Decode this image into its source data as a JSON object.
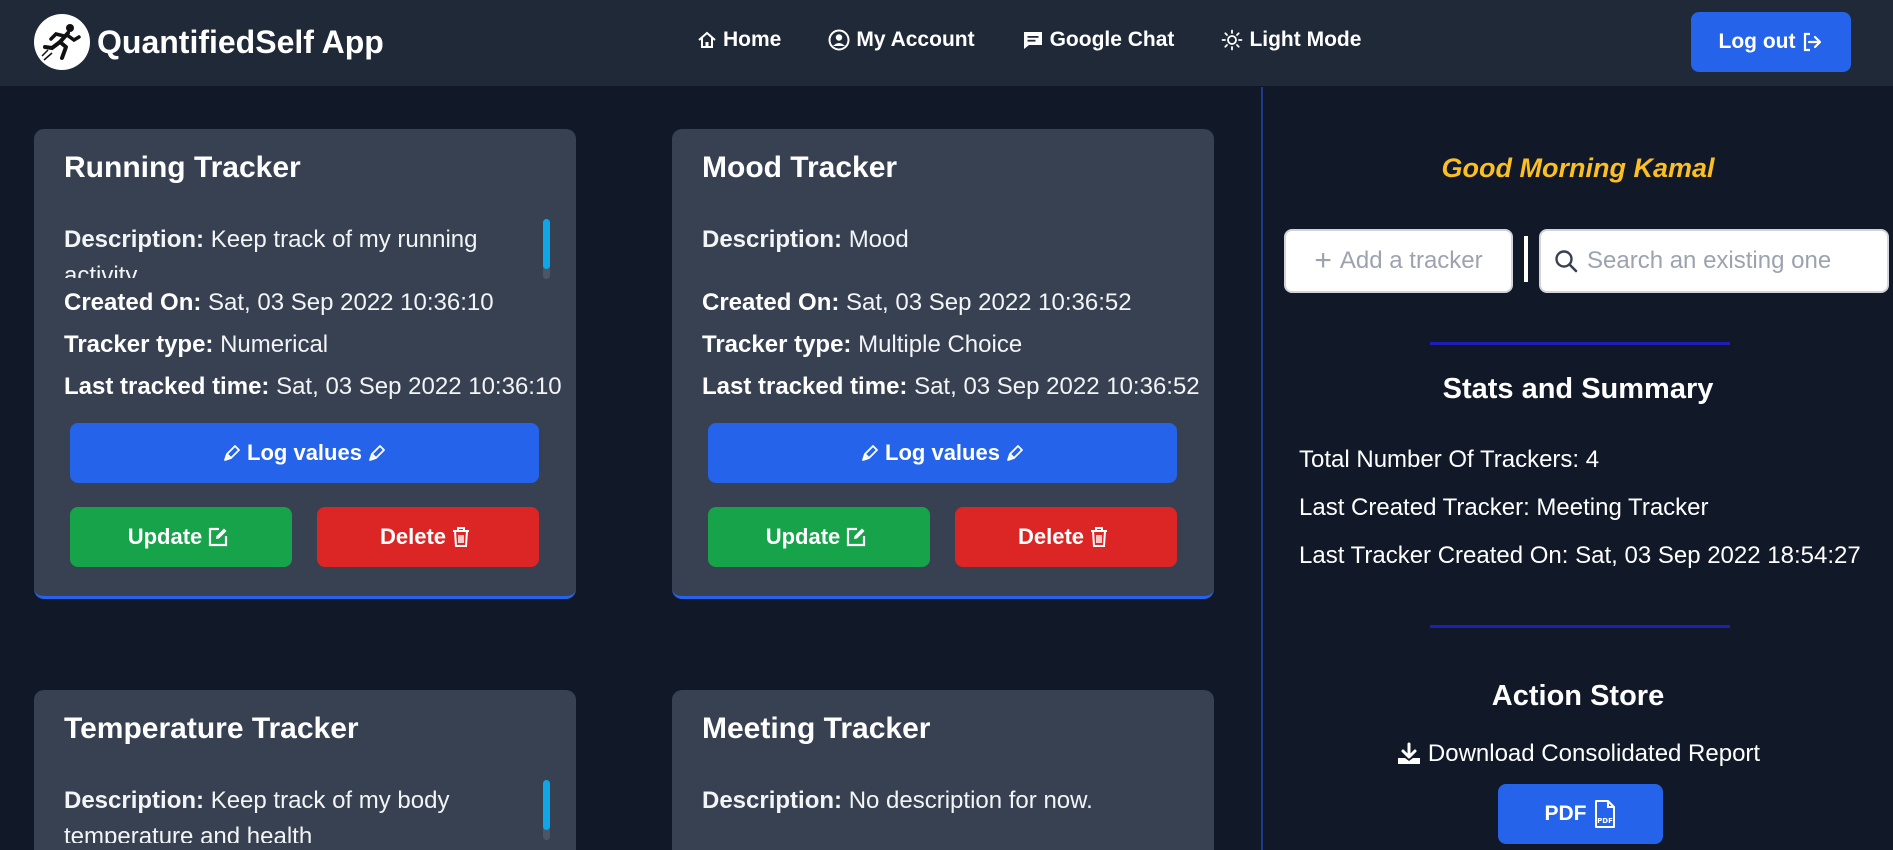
{
  "navbar": {
    "brand": "QuantifiedSelf App",
    "links": [
      {
        "label": "Home",
        "icon": "home-icon"
      },
      {
        "label": "My Account",
        "icon": "user-circle-icon"
      },
      {
        "label": "Google Chat",
        "icon": "chat-icon"
      },
      {
        "label": "Light Mode",
        "icon": "sun-icon"
      }
    ],
    "logout_label": "Log out"
  },
  "labels": {
    "description": "Description:",
    "created_on": "Created On:",
    "tracker_type": "Tracker type:",
    "last_tracked": "Last tracked time:",
    "log_values": "Log values",
    "update": "Update",
    "delete": "Delete"
  },
  "trackers": [
    {
      "name": "Running Tracker",
      "description": "Keep track of my running activity",
      "created_on": "Sat, 03 Sep 2022 10:36:10",
      "tracker_type": "Numerical",
      "last_tracked": "Sat, 03 Sep 2022 10:36:10"
    },
    {
      "name": "Mood Tracker",
      "description": "Mood",
      "created_on": "Sat, 03 Sep 2022 10:36:52",
      "tracker_type": "Multiple Choice",
      "last_tracked": "Sat, 03 Sep 2022 10:36:52"
    },
    {
      "name": "Temperature Tracker",
      "description": "Keep track of my body temperature and health"
    },
    {
      "name": "Meeting Tracker",
      "description": "No description for now."
    }
  ],
  "sidebar": {
    "greeting": "Good Morning Kamal",
    "add_tracker_label": "Add a tracker",
    "search_placeholder": "Search an existing one",
    "stats_title": "Stats and Summary",
    "stats": {
      "total": "Total Number Of Trackers: 4",
      "last_created": "Last Created Tracker: Meeting Tracker",
      "last_created_on": "Last Tracker Created On: Sat, 03 Sep 2022 18:54:27"
    },
    "action_title": "Action Store",
    "download_label": "Download Consolidated Report",
    "pdf_label": "PDF"
  },
  "colors": {
    "background": "#111827",
    "navbar": "#1f2937",
    "card": "#374151",
    "primary": "#2563eb",
    "success": "#16a34a",
    "danger": "#dc2626",
    "greeting": "#fbbf24"
  }
}
